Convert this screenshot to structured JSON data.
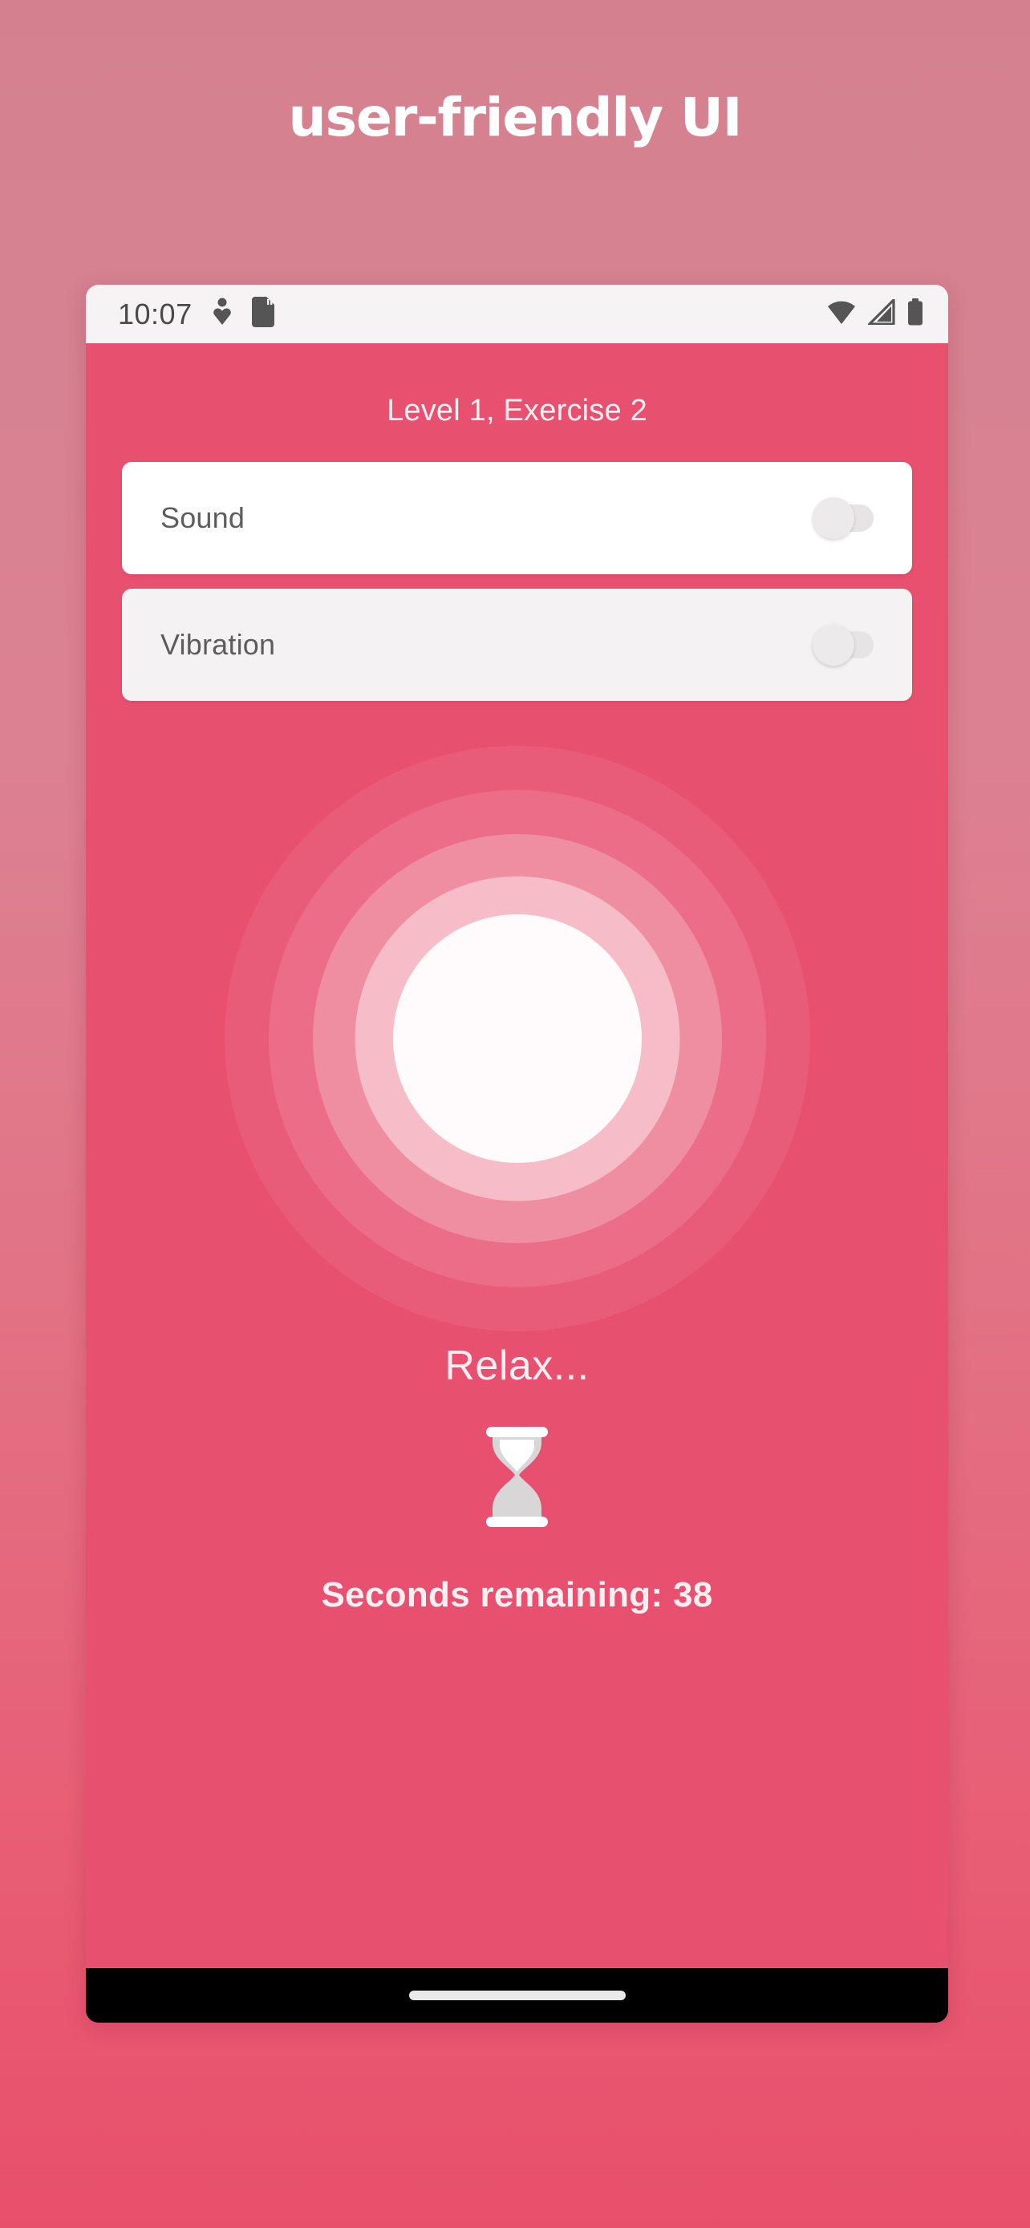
{
  "page": {
    "title": "user-friendly UI"
  },
  "phone": {
    "status_bar": {
      "time": "10:07",
      "left_icons": [
        "heart-health-icon",
        "sd-card-icon"
      ],
      "right_icons": [
        "wifi-icon",
        "cellular-signal-icon",
        "battery-icon"
      ]
    },
    "navigation_bar": {
      "gesture_pill": "home-gesture-pill"
    }
  },
  "app": {
    "header": "Level 1, Exercise 2",
    "settings": [
      {
        "label": "Sound",
        "toggle_state": "off",
        "card_style": "white"
      },
      {
        "label": "Vibration",
        "toggle_state": "off",
        "card_style": "grey"
      }
    ],
    "breathing": {
      "instruction": "Relax...",
      "timer_icon": "hourglass-icon",
      "timer_label": "Seconds remaining: 38"
    }
  },
  "colors": {
    "accent_pink": "#e8506f",
    "background_top": "#d4818f",
    "background_bottom": "#e84f6b",
    "card_white": "#ffffff",
    "card_grey": "#f4f2f2",
    "status_bar_bg": "#f5f3f3",
    "nav_bar_bg": "#000000",
    "text_light": "#fdeef1",
    "label_grey": "#5d5d5d"
  }
}
